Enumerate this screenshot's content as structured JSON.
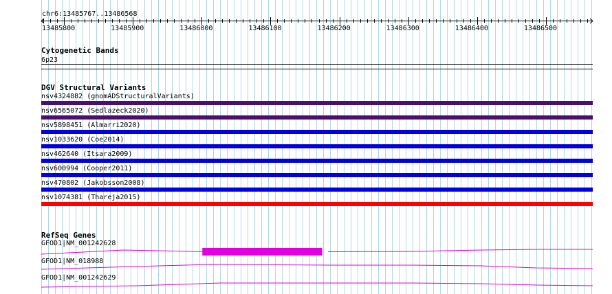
{
  "ruler": {
    "position_label": "chr6:13485767..13486568",
    "start": 13485767,
    "end": 13486568,
    "ticks": [
      "13485800",
      "13485900",
      "13486000",
      "13486100",
      "13486200",
      "13486300",
      "13486400",
      "13486500"
    ]
  },
  "cytogenetic": {
    "title": "Cytogenetic Bands",
    "band": "6p23"
  },
  "dgv": {
    "title": "DGV Structural Variants",
    "variants": [
      {
        "label": "nsv4324882 (gnomADStructuralVariants)",
        "color": "#4b0f6e"
      },
      {
        "label": "nsv6565072 (Sedlazeck2020)",
        "color": "#4b0f6e"
      },
      {
        "label": "nsv5898451 (Almarri2020)",
        "color": "#0000e0"
      },
      {
        "label": "nsv1033620 (Coe2014)",
        "color": "#0000e0"
      },
      {
        "label": "nsv462640 (Itsara2009)",
        "color": "#0000e0"
      },
      {
        "label": "nsv600994 (Cooper2011)",
        "color": "#0000e0"
      },
      {
        "label": "nsv470802 (Jakobsson2008)",
        "color": "#0000e0"
      },
      {
        "label": "nsv1074381 (Thareja2015)",
        "color": "#ff0000"
      }
    ]
  },
  "refseq": {
    "title": "RefSeq Genes",
    "color": "#e000e0",
    "genes": [
      {
        "label": "GFOD1|NM_001242628",
        "exon_start": 13486001,
        "exon_end": 13486175
      },
      {
        "label": "GFOD1|NM_018988"
      },
      {
        "label": "GFOD1|NM_001242629"
      }
    ]
  },
  "colors": {
    "grid": "#add8e6",
    "ruler": "#000000"
  }
}
